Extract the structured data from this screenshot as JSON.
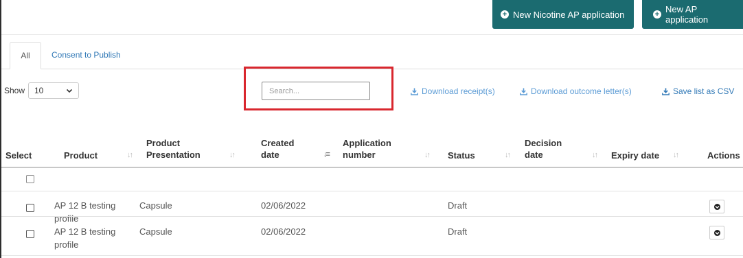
{
  "header": {
    "new_nicotine_label": "New Nicotine AP application",
    "new_ap_label": "New AP application"
  },
  "tabs": [
    {
      "label": "All",
      "active": true
    },
    {
      "label": "Consent to Publish",
      "active": false
    }
  ],
  "toolbar": {
    "show_label": "Show",
    "page_length": "10",
    "search_placeholder": "Search...",
    "download_receipts": "Download receipt(s)",
    "download_outcome": "Download outcome letter(s)",
    "save_csv": "Save list as CSV"
  },
  "table": {
    "columns": [
      {
        "line1": "Select",
        "line2": ""
      },
      {
        "line1": "Product",
        "line2": ""
      },
      {
        "line1": "Product",
        "line2": "Presentation"
      },
      {
        "line1": "Created",
        "line2": "date"
      },
      {
        "line1": "Application",
        "line2": "number"
      },
      {
        "line1": "Status",
        "line2": ""
      },
      {
        "line1": "Decision",
        "line2": "date"
      },
      {
        "line1": "Expiry date",
        "line2": ""
      },
      {
        "line1": "Actions",
        "line2": ""
      }
    ],
    "rows": [
      {
        "product_line1": "AP 12 B testing",
        "product_line2": "profile",
        "presentation": "Capsule",
        "created": "02/06/2022",
        "application_number": "",
        "status": "Draft",
        "decision_date": "",
        "expiry_date": ""
      },
      {
        "product_line1": "AP 12 B testing",
        "product_line2": "profile",
        "presentation": "Capsule",
        "created": "02/06/2022",
        "application_number": "",
        "status": "Draft",
        "decision_date": "",
        "expiry_date": ""
      }
    ]
  },
  "colors": {
    "primary_button": "#1b6b70",
    "link": "#337ab7",
    "highlight": "#d9272e"
  }
}
